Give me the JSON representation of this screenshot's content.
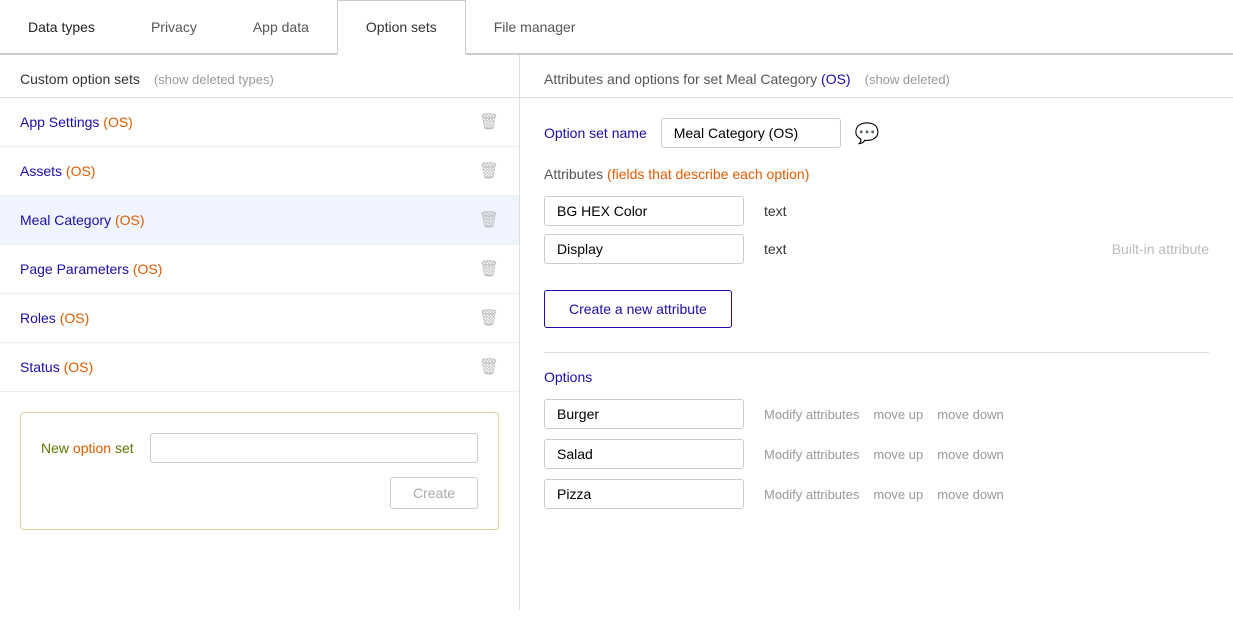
{
  "tabs": [
    {
      "id": "data-types",
      "label": "Data types",
      "active": false
    },
    {
      "id": "privacy",
      "label": "Privacy",
      "active": false
    },
    {
      "id": "app-data",
      "label": "App data",
      "active": false
    },
    {
      "id": "option-sets",
      "label": "Option sets",
      "active": true
    },
    {
      "id": "file-manager",
      "label": "File manager",
      "active": false
    }
  ],
  "left_panel": {
    "section_title": "Custom option sets",
    "show_deleted_label": "(show deleted types)",
    "items": [
      {
        "id": "app-settings",
        "label": "App Settings",
        "tag": "(OS)",
        "selected": false
      },
      {
        "id": "assets",
        "label": "Assets",
        "tag": "(OS)",
        "selected": false
      },
      {
        "id": "meal-category",
        "label": "Meal Category",
        "tag": "(OS)",
        "selected": true
      },
      {
        "id": "page-parameters",
        "label": "Page Parameters",
        "tag": "(OS)",
        "selected": false
      },
      {
        "id": "roles",
        "label": "Roles",
        "tag": "(OS)",
        "selected": false
      },
      {
        "id": "status",
        "label": "Status",
        "tag": "(OS)",
        "selected": false
      }
    ],
    "new_option_set": {
      "label_prefix": "New option",
      "label_suffix": "set",
      "input_placeholder": "",
      "create_button_label": "Create"
    }
  },
  "right_panel": {
    "header": {
      "title_prefix": "Attributes and options for set Meal Category",
      "title_tag": "(OS)",
      "show_deleted_label": "(show deleted)"
    },
    "option_set_name": {
      "label": "Option set name",
      "value": "Meal Category (OS)"
    },
    "attributes_label": "Attributes ",
    "attributes_desc": "(fields that describe each option)",
    "attributes": [
      {
        "id": "bg-hex-color",
        "value": "BG HEX Color",
        "type": "text",
        "builtin": false
      },
      {
        "id": "display",
        "value": "Display",
        "type": "text",
        "builtin": true,
        "builtin_label": "Built-in attribute"
      }
    ],
    "create_attribute_button": "Create a new attribute",
    "options_label": "Options",
    "options": [
      {
        "id": "burger",
        "value": "Burger"
      },
      {
        "id": "salad",
        "value": "Salad"
      },
      {
        "id": "pizza",
        "value": "Pizza"
      }
    ],
    "option_actions": {
      "modify": "Modify attributes",
      "move_up": "move up",
      "move_down": "move down"
    },
    "comment_icon": "💬"
  }
}
